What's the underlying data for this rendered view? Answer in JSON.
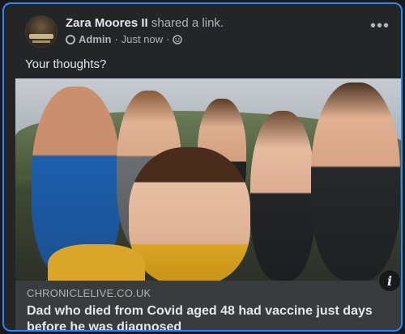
{
  "post": {
    "author_name": "Zara Moores II",
    "action": "shared a link.",
    "role": "Admin",
    "timestamp": "Just now",
    "separator": "·",
    "more_icon": "more-horizontal-icon",
    "text": "Your thoughts?"
  },
  "link_preview": {
    "domain": "CHRONICLELIVE.CO.UK",
    "title": "Dad who died from Covid aged 48 had vaccine just days before he was diagnosed",
    "info_icon": "info-icon"
  },
  "colors": {
    "card_bg": "#242526",
    "focus_border": "#2d88ff",
    "preview_bg": "#3a3b3c",
    "text_primary": "#e4e6eb",
    "text_secondary": "#b0b3b8"
  }
}
